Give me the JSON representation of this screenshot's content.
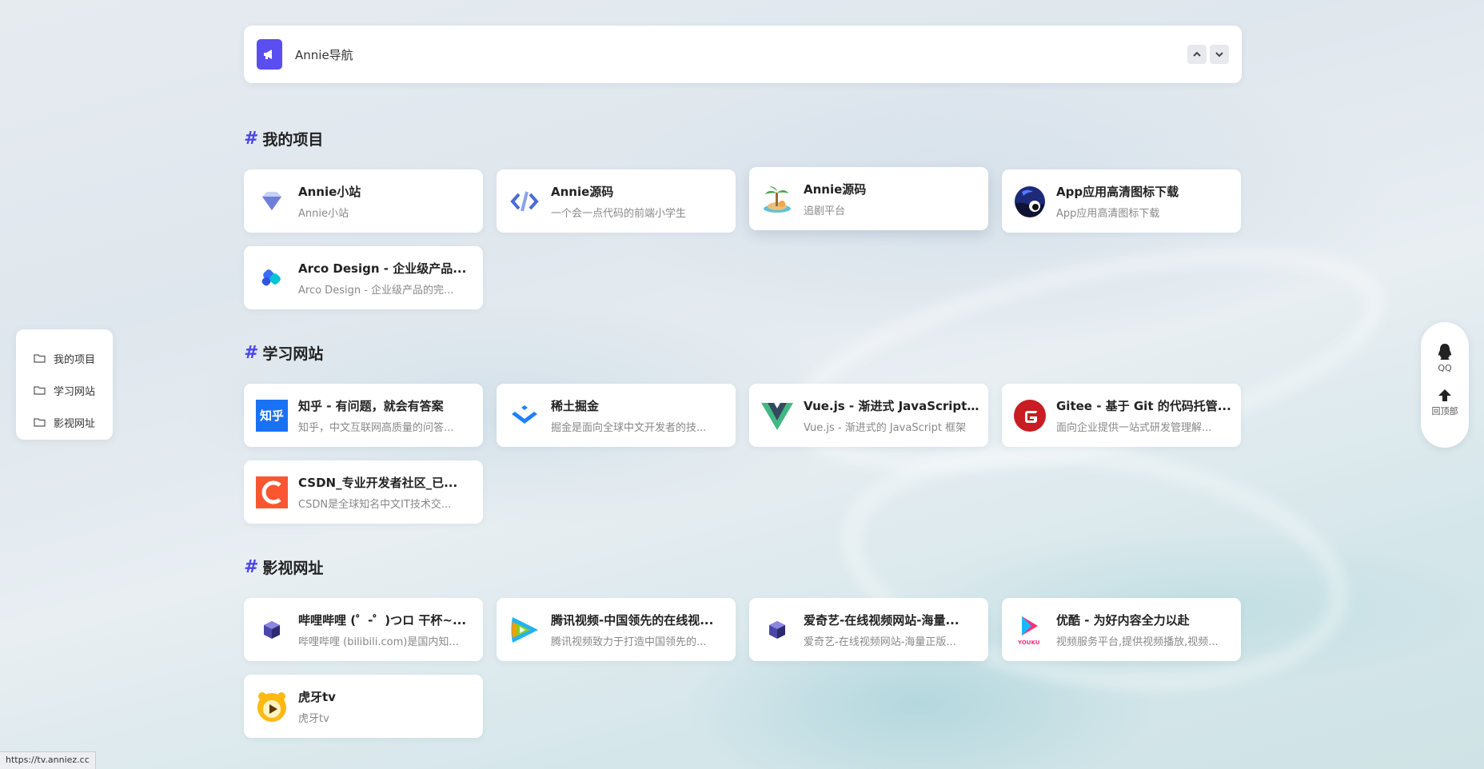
{
  "notice": {
    "text": "Annie导航"
  },
  "sections": [
    {
      "title": "我的项目",
      "cards": [
        {
          "title": "Annie小站",
          "desc": "Annie小站",
          "icon": "diamond-icon"
        },
        {
          "title": "Annie源码",
          "desc": "一个会一点代码的前端小学生",
          "icon": "code-icon"
        },
        {
          "title": "Annie源码",
          "desc": "追剧平台",
          "icon": "island-icon"
        },
        {
          "title": "App应用高清图标下载",
          "desc": "App应用高清图标下载",
          "icon": "app-icon"
        },
        {
          "title": "Arco Design - 企业级产品...",
          "desc": "Arco Design - 企业级产品的完...",
          "icon": "arco-icon"
        }
      ]
    },
    {
      "title": "学习网站",
      "cards": [
        {
          "title": "知乎 - 有问题，就会有答案",
          "desc": "知乎，中文互联网高质量的问答...",
          "icon": "zhihu-icon"
        },
        {
          "title": "稀土掘金",
          "desc": "掘金是面向全球中文开发者的技...",
          "icon": "juejin-icon"
        },
        {
          "title": "Vue.js - 渐进式 JavaScript ...",
          "desc": "Vue.js - 渐进式的 JavaScript 框架",
          "icon": "vue-icon"
        },
        {
          "title": "Gitee - 基于 Git 的代码托管...",
          "desc": "面向企业提供一站式研发管理解...",
          "icon": "gitee-icon"
        },
        {
          "title": "CSDN_专业开发者社区_已...",
          "desc": "CSDN是全球知名中文IT技术交...",
          "icon": "csdn-icon"
        }
      ]
    },
    {
      "title": "影视网址",
      "cards": [
        {
          "title": "哔哩哔哩 (゜-゜)つロ 干杯~...",
          "desc": "哔哩哔哩 (bilibili.com)是国内知...",
          "icon": "cube-icon"
        },
        {
          "title": "腾讯视频-中国领先的在线视...",
          "desc": "腾讯视频致力于打造中国领先的...",
          "icon": "tencent-video-icon"
        },
        {
          "title": "爱奇艺-在线视频网站-海量...",
          "desc": "爱奇艺-在线视频网站-海量正版...",
          "icon": "cube-icon"
        },
        {
          "title": "优酷 - 为好内容全力以赴",
          "desc": "视频服务平台,提供视频播放,视频...",
          "icon": "youku-icon"
        },
        {
          "title": "虎牙tv",
          "desc": "虎牙tv",
          "icon": "huya-icon"
        }
      ]
    }
  ],
  "side_nav": {
    "items": [
      "我的项目",
      "学习网站",
      "影视网址"
    ]
  },
  "right_bar": {
    "qq_label": "QQ",
    "top_label": "回顶部"
  },
  "status_url": "https://tv.anniez.cc",
  "colors": {
    "accent": "#4b46e6",
    "notice_icon_bg": "#5b4ef0"
  }
}
